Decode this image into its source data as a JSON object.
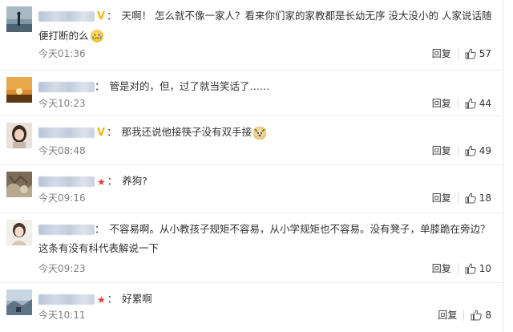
{
  "comments": [
    {
      "badge": "V",
      "text": "天啊！ 怎么就不像一家人？看来你们家的家教都是长幼无序 没大没小的 人家说话随便打断的么",
      "emoji": "cry-emoji",
      "time": "今天01:36",
      "likes": "57"
    },
    {
      "badge": "",
      "text": "管是对的，但，过了就当笑话了……",
      "emoji": "",
      "time": "今天10:23",
      "likes": "44"
    },
    {
      "badge": "V",
      "text": "那我还说他接筷子没有双手接",
      "emoji": "dog-emoji",
      "time": "今天08:48",
      "likes": "49"
    },
    {
      "badge": "star",
      "text": "养狗?",
      "emoji": "",
      "time": "今天09:16",
      "likes": "18"
    },
    {
      "badge": "",
      "text": "不容易啊。从小教孩子规矩不容易，从小学规矩也不容易。没有凳子，单膝跪在旁边？这条有没有科代表解说一下",
      "emoji": "",
      "time": "今天09:23",
      "likes": "10"
    },
    {
      "badge": "star",
      "text": "好累啊",
      "emoji": "",
      "time": "今天10:11",
      "likes": "8"
    }
  ],
  "labels": {
    "reply": "回复",
    "colon": "："
  },
  "colors": {
    "v_badge": "#f7b500",
    "star_badge": "#e8373a",
    "muted_text": "#808080"
  }
}
